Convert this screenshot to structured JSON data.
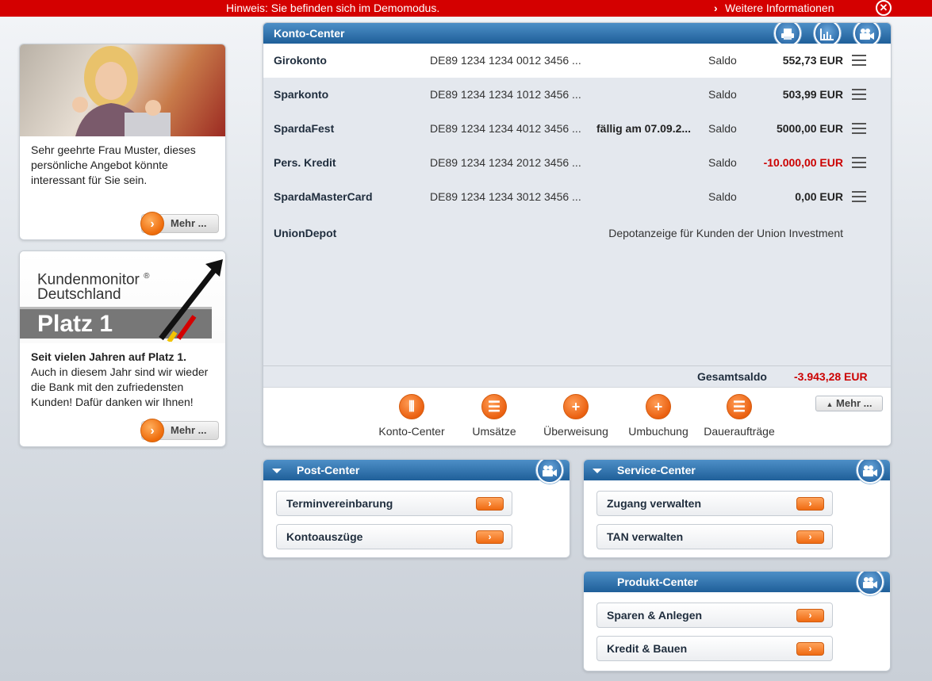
{
  "notice": {
    "text": "Hinweis: Sie befinden sich im Demomodus.",
    "more_link": "Weitere Informationen",
    "close_icon": "close-icon"
  },
  "promo1": {
    "text": "Sehr geehrte Frau Muster, dieses persönliche Angebot könnte interessant für Sie sein.",
    "button": "Mehr ..."
  },
  "promo2": {
    "logo_line1": "Kundenmonitor",
    "logo_line2": "Deutschland",
    "logo_platz": "Platz 1",
    "headline": "Seit vielen Jahren auf Platz 1.",
    "text": "Auch in diesem Jahr sind wir wieder die Bank mit den zufriedensten Kunden! Dafür danken wir Ihnen!",
    "button": "Mehr ..."
  },
  "konto": {
    "title": "Konto-Center",
    "accounts": [
      {
        "name": "Girokonto",
        "iban": "DE89 1234 1234 0012 3456 ...",
        "note": "",
        "label": "Saldo",
        "amount": "552,73 EUR",
        "negative": false
      },
      {
        "name": "Sparkonto",
        "iban": "DE89 1234 1234 1012 3456 ...",
        "note": "",
        "label": "Saldo",
        "amount": "503,99 EUR",
        "negative": false
      },
      {
        "name": "SpardaFest",
        "iban": "DE89 1234 1234 4012 3456 ...",
        "note": "fällig am 07.09.2...",
        "label": "Saldo",
        "amount": "5000,00 EUR",
        "negative": false
      },
      {
        "name": "Pers. Kredit",
        "iban": "DE89 1234 1234 2012 3456 ...",
        "note": "",
        "label": "Saldo",
        "amount": "-10.000,00 EUR",
        "negative": true
      },
      {
        "name": "SpardaMasterCard",
        "iban": "DE89 1234 1234 3012 3456 ...",
        "note": "",
        "label": "Saldo",
        "amount": "0,00 EUR",
        "negative": false
      }
    ],
    "depot": {
      "name": "UnionDepot",
      "text": "Depotanzeige für Kunden der Union Investment"
    },
    "total_label": "Gesamtsaldo",
    "total_value": "-3.943,28 EUR",
    "actions": [
      {
        "label": "Konto-Center",
        "icon": "columns-icon"
      },
      {
        "label": "Umsätze",
        "icon": "list-icon"
      },
      {
        "label": "Überweisung",
        "icon": "plus-icon"
      },
      {
        "label": "Umbuchung",
        "icon": "plus-icon"
      },
      {
        "label": "Daueraufträge",
        "icon": "list-icon"
      }
    ],
    "more": "Mehr ..."
  },
  "post_center": {
    "title": "Post-Center",
    "items": [
      "Terminvereinbarung",
      "Kontoauszüge"
    ]
  },
  "service_center": {
    "title": "Service-Center",
    "items": [
      "Zugang verwalten",
      "TAN verwalten"
    ]
  },
  "produkt_center": {
    "title": "Produkt-Center",
    "items": [
      "Sparen & Anlegen",
      "Kredit & Bauen"
    ]
  },
  "colors": {
    "brand_red": "#d40000",
    "header_blue": "#1f5f99",
    "accent_orange": "#ee6b0a",
    "negative": "#cc0000"
  }
}
